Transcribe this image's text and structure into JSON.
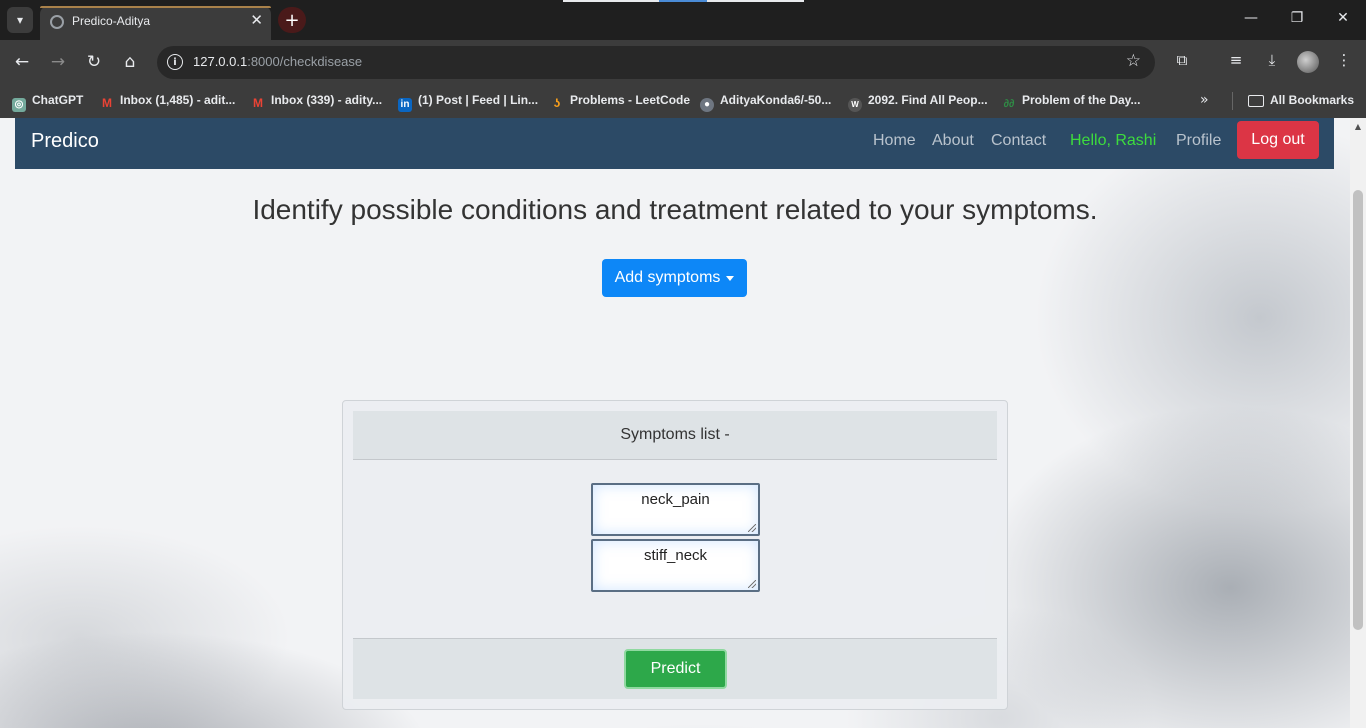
{
  "browser": {
    "tab_title": "Predico-Aditya",
    "url_host": "127.0.0.1",
    "url_path": ":8000/checkdisease",
    "bookmarks": [
      {
        "label": "ChatGPT",
        "icon": "chatgpt-icon",
        "color": "#74aa9c"
      },
      {
        "label": "Inbox (1,485) - adit...",
        "icon": "gmail-icon",
        "color": "#ea4335"
      },
      {
        "label": "Inbox (339) - adity...",
        "icon": "gmail-icon",
        "color": "#ea4335"
      },
      {
        "label": "(1) Post | Feed | Lin...",
        "icon": "linkedin-icon",
        "color": "#0a66c2"
      },
      {
        "label": "Problems - LeetCode",
        "icon": "leetcode-icon",
        "color": "#f89f1b"
      },
      {
        "label": "AdityaKonda6/-50...",
        "icon": "github-icon",
        "color": "#6e7681"
      },
      {
        "label": "2092. Find All Peop...",
        "icon": "walkccc-icon",
        "color": "#555555"
      },
      {
        "label": "Problem of the Day...",
        "icon": "gfg-icon",
        "color": "#2f8d46"
      }
    ],
    "all_bookmarks_label": "All Bookmarks"
  },
  "navbar": {
    "brand": "Predico",
    "links": [
      "Home",
      "About",
      "Contact"
    ],
    "greeting": "Hello, Rashi",
    "profile": "Profile",
    "logout": "Log out",
    "bg_color": "#2c4a66"
  },
  "main": {
    "headline": "Identify possible conditions and treatment related to your symptoms.",
    "add_button": "Add symptoms"
  },
  "card": {
    "header": "Symptoms list -",
    "symptoms": [
      "neck_pain",
      "stiff_neck"
    ],
    "predict_button": "Predict"
  },
  "colors": {
    "primary": "#0d87f7",
    "danger": "#dc3545",
    "success": "#2da84a",
    "greeting": "#3ddc3d"
  }
}
